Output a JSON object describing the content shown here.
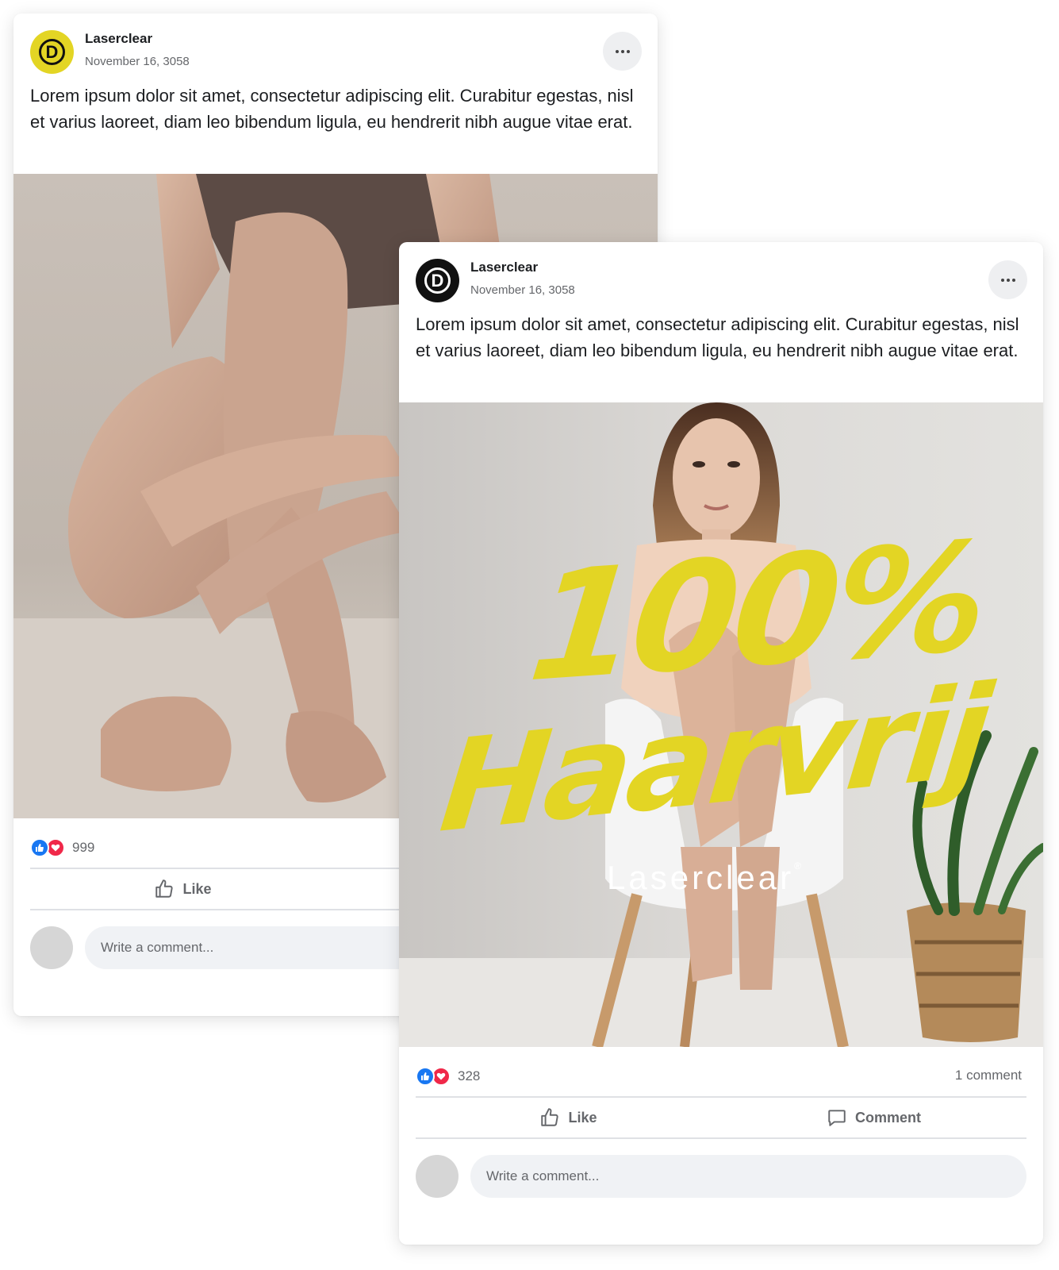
{
  "colors": {
    "brand_yellow": "#e3d524",
    "like_blue": "#1877f2",
    "love_red": "#f02849",
    "meta_gray": "#65676b"
  },
  "posts": [
    {
      "page_name": "Laserclear",
      "date": "November 16, 3058",
      "text": "Lorem ipsum dolor sit amet, consectetur adipiscing elit. Curabitur egestas, nisl et varius laoreet, diam leo bibendum ligula, eu hendrerit nibh augue vitae erat.",
      "avatar_letter": "D",
      "avatar_style": "yellow",
      "image_subject": "woman sitting on floor hugging legs",
      "reaction_count": "999",
      "like_label": "Like",
      "comment_placeholder": "Write a comment..."
    },
    {
      "page_name": "Laserclear",
      "date": "November 16, 3058",
      "text": "Lorem ipsum dolor sit amet, consectetur adipiscing elit. Curabitur egestas, nisl et varius laoreet, diam leo bibendum ligula, eu hendrerit nibh augue vitae erat.",
      "avatar_letter": "D",
      "avatar_style": "black",
      "image_subject": "woman on white chair with plant",
      "image_headline_1": "100%",
      "image_headline_2": "Haarvrij",
      "image_brand": "Laserclear",
      "image_brand_mark": "®",
      "reaction_count": "328",
      "comment_count": "1 comment",
      "like_label": "Like",
      "comment_label": "Comment",
      "comment_placeholder": "Write a comment..."
    }
  ]
}
